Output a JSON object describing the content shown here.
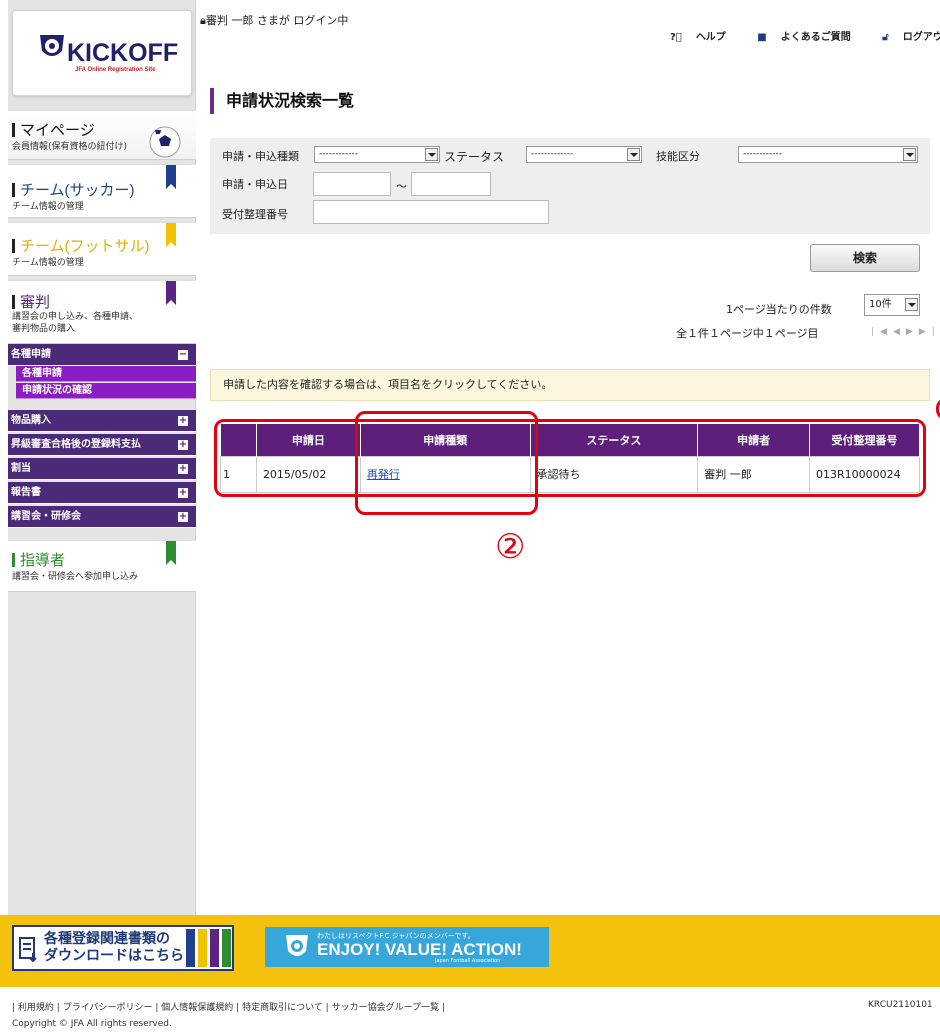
{
  "header": {
    "login_status": "審判 一郎 さまが ログイン中",
    "help": "ヘルプ",
    "faq": "よくあるご質問",
    "logout": "ログアウト"
  },
  "logo": {
    "word": "KICKOFF",
    "sub": "JFA Online Registration Site"
  },
  "sidebar": {
    "mypage": {
      "title": "マイページ",
      "sub": "会員情報(保有資格の紐付け)"
    },
    "team_soccer": {
      "title": "チーム(サッカー)",
      "sub": "チーム情報の管理",
      "color": "#1f3f8f"
    },
    "team_futsal": {
      "title": "チーム(フットサル)",
      "sub": "チーム情報の管理",
      "color": "#f2c200"
    },
    "referee": {
      "title": "審判",
      "sub1": "講習会の申し込み、各種申請、",
      "sub2": "審判物品の購入",
      "color": "#5b2382"
    },
    "menu": [
      {
        "label": "各種申請",
        "toggle": "−"
      },
      {
        "label": "物品購入",
        "toggle": "+"
      },
      {
        "label": "昇級審査合格後の登録料支払",
        "toggle": "+"
      },
      {
        "label": "割当",
        "toggle": "+"
      },
      {
        "label": "報告書",
        "toggle": "+"
      },
      {
        "label": "講習会・研修会",
        "toggle": "+"
      }
    ],
    "submenu": [
      "各種申請",
      "申請状況の確認"
    ],
    "coach": {
      "title": "指導者",
      "sub": "講習会・研修会へ参加申し込み",
      "color": "#2f8c2f"
    }
  },
  "main": {
    "title": "申請状況検索一覧",
    "search": {
      "type_label": "申請・申込種類",
      "type_value": "------------",
      "status_label": "ステータス",
      "status_value": "-------------",
      "skill_label": "技能区分",
      "skill_value": "------------",
      "date_label": "申請・申込日",
      "date_sep": "～",
      "number_label": "受付整理番号",
      "button": "検索"
    },
    "perpage_label": "1ページ当たりの件数",
    "perpage_value": "10件",
    "pager_text": "全１件１ページ中１ページ目",
    "notice": "申請した内容を確認する場合は、項目名をクリックしてください。",
    "table": {
      "headers": [
        "",
        "申請日",
        "申請種類",
        "ステータス",
        "申請者",
        "受付整理番号"
      ],
      "row": {
        "no": "1",
        "date": "2015/05/02",
        "type": "再発行",
        "status": "承認待ち",
        "applicant": "審判 一郎",
        "number": "013R10000024"
      }
    },
    "annotation_number": "②"
  },
  "footer": {
    "download_line1": "各種登録関連書類の",
    "download_line2": "ダウンロードはこちら",
    "respect_small": "わたしはリスペクトF.C.ジャパンのメンバーです。",
    "respect_main": "ENJOY! VALUE! ACTION!",
    "respect_jfa": "Japan Football Association",
    "links": [
      "利用規約",
      "プライバシーポリシー",
      "個人情報保護規約",
      "特定商取引について",
      "サッカー協会グループ一覧"
    ],
    "code": "KRCU2110101",
    "copyright": "Copyright © JFA All rights reserved."
  },
  "colors": {
    "accent_purple": "#5d1e7c",
    "menu_purple": "#4c2a7a",
    "submenu_magenta": "#8b1ec2",
    "annotation_red": "#e3000f",
    "footer_yellow": "#f4c20d"
  }
}
